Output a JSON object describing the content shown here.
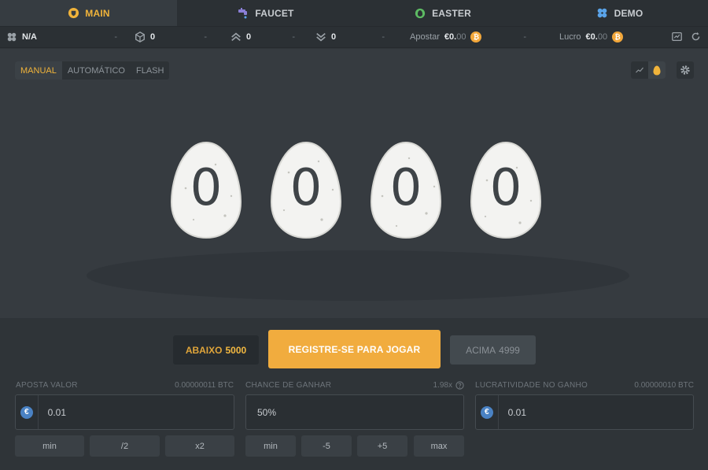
{
  "tabs": [
    {
      "label": "MAIN",
      "icon": "shield-icon",
      "active": true
    },
    {
      "label": "FAUCET",
      "icon": "faucet-icon",
      "active": false
    },
    {
      "label": "EASTER",
      "icon": "easter-egg-icon",
      "active": false
    },
    {
      "label": "DEMO",
      "icon": "puzzle-icon",
      "active": false
    }
  ],
  "stats": {
    "level": "N/A",
    "sep": "-",
    "bets": "0",
    "wins": "0",
    "losses": "0",
    "bet_label": "Apostar",
    "bet_value": "€0.",
    "bet_value_muted": "00",
    "profit_label": "Lucro",
    "profit_value": "€0.",
    "profit_value_muted": "00",
    "coin_symbol": "₿"
  },
  "modes": [
    "MANUAL",
    "AUTOMÁTICO",
    "FLASH"
  ],
  "eggs": [
    "0",
    "0",
    "0",
    "0"
  ],
  "controls": {
    "below_label": "ABAIXO",
    "below_value": "5000",
    "main_label": "REGISTRE-SE PARA JOGAR",
    "above_label": "ACIMA",
    "above_value": "4999"
  },
  "fields": {
    "bet": {
      "label": "APOSTA VALOR",
      "info": "0.00000011 BTC",
      "value": "0.01",
      "currency": "€"
    },
    "chance": {
      "label": "CHANCE DE GANHAR",
      "info": "1.98x",
      "value": "50%"
    },
    "profit": {
      "label": "LUCRATIVIDADE NO GANHO",
      "info": "0.00000010 BTC",
      "value": "0.01",
      "currency": "€"
    }
  },
  "bet_buttons": [
    "min",
    "/2",
    "x2"
  ],
  "chance_buttons": [
    "min",
    "-5",
    "+5",
    "max"
  ],
  "colors": {
    "accent": "#f1ac3e",
    "background": "#2f3438",
    "euro": "#4a82c4"
  }
}
